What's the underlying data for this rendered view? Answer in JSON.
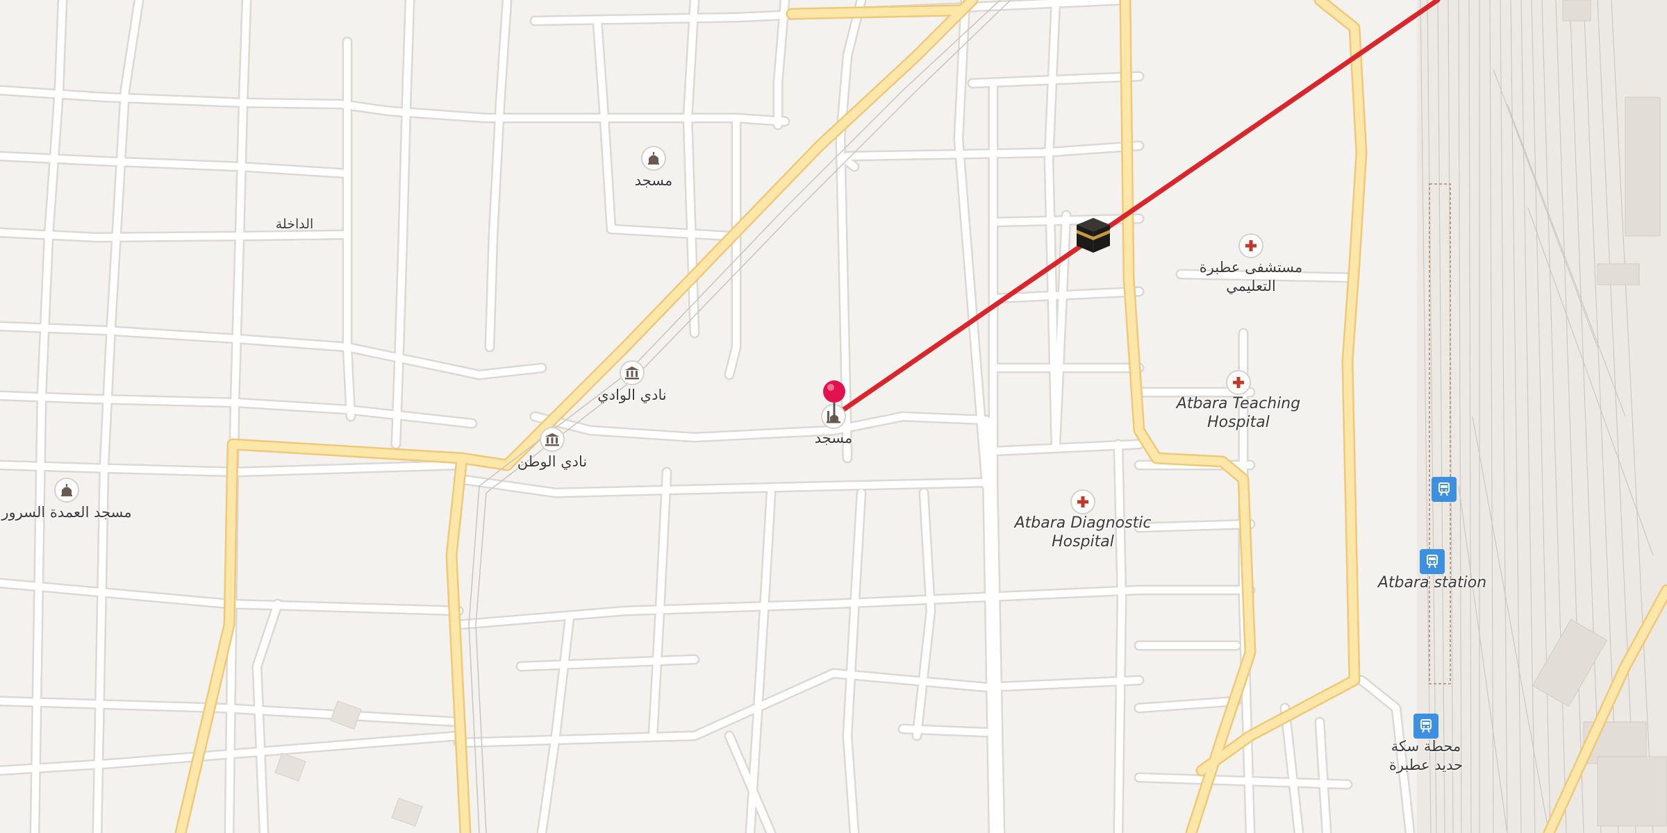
{
  "map": {
    "labels": {
      "mosque_top": "مسجد",
      "dakhla": "الداخلة",
      "club_wadi": "نادي الوادي",
      "club_watan": "نادي الوطن",
      "mosque_center": "مسجد",
      "mosque_sorour": "مسجد العمدة السرور",
      "hospital_ar_line1": "مستشفى عطبرة",
      "hospital_ar_line2": "التعليمي",
      "hospital_en_line1": "Atbara Teaching",
      "hospital_en_line2": "Hospital",
      "diag_line1": "Atbara Diagnostic",
      "diag_line2": "Hospital",
      "station_en": "Atbara station",
      "station_ar_line1": "محطة سكة",
      "station_ar_line2": "حديد عطبرة"
    },
    "markers": {
      "selected_pin": "red-pin-icon",
      "qibla_target": "kaaba-icon",
      "qibla_line_color": "#d9262c"
    },
    "colors": {
      "background": "#f4f2ef",
      "road": "#ffffff",
      "road_casing": "#dcd8d3",
      "main_road": "#fde7a8",
      "main_road_casing": "#efc879",
      "rail_station": "#3d8fe0",
      "hospital_cross": "#c0392b"
    }
  }
}
